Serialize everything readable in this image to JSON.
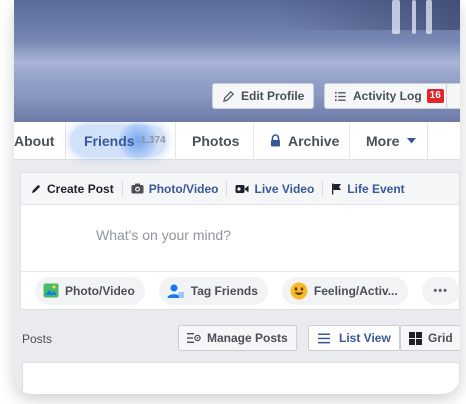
{
  "cover": {
    "edit_profile_label": "Edit Profile",
    "activity_log_label": "Activity Log",
    "activity_log_badge": "16"
  },
  "tabs": {
    "about": "About",
    "friends": "Friends",
    "friends_count": "1,374",
    "photos": "Photos",
    "archive": "Archive",
    "more": "More"
  },
  "composer": {
    "tabs": {
      "create_post": "Create Post",
      "photo_video": "Photo/Video",
      "live_video": "Live Video",
      "life_event": "Life Event"
    },
    "placeholder": "What's on your mind?",
    "actions": {
      "photo_video": "Photo/Video",
      "tag_friends": "Tag Friends",
      "feeling": "Feeling/Activ...",
      "more": "•••"
    }
  },
  "posts": {
    "label": "Posts",
    "manage_posts": "Manage Posts",
    "list_view": "List View",
    "grid": "Grid"
  },
  "colors": {
    "link_blue": "#385898",
    "badge_red": "#e4242b",
    "highlight_blue": "#5b92eb"
  }
}
